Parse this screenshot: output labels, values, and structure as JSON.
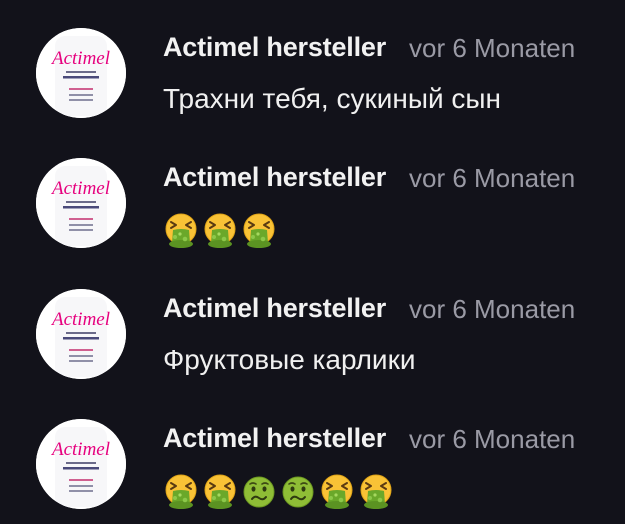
{
  "colors": {
    "background": "#12121a",
    "author": "#f2f2f2",
    "timestamp": "#9a9aa5",
    "comment_text": "#f0f0f0",
    "avatar_brand": "#e6007e"
  },
  "avatar": {
    "brand_text": "Actimel",
    "icon": "actimel-bottle-avatar"
  },
  "comments": [
    {
      "author": "Actimel hersteller",
      "time": "vor 6 Monaten",
      "text": "Трахни тебя, сукиный сын",
      "emojis": []
    },
    {
      "author": "Actimel hersteller",
      "time": "vor 6 Monaten",
      "text": "",
      "emojis": [
        "vomiting-face",
        "vomiting-face",
        "vomiting-face"
      ]
    },
    {
      "author": "Actimel hersteller",
      "time": "vor 6 Monaten",
      "text": "Фруктовые карлики",
      "emojis": []
    },
    {
      "author": "Actimel hersteller",
      "time": "vor 6 Monaten",
      "text": "",
      "emojis": [
        "vomiting-face",
        "vomiting-face",
        "nauseated-face",
        "nauseated-face",
        "vomiting-face",
        "vomiting-face"
      ]
    }
  ]
}
